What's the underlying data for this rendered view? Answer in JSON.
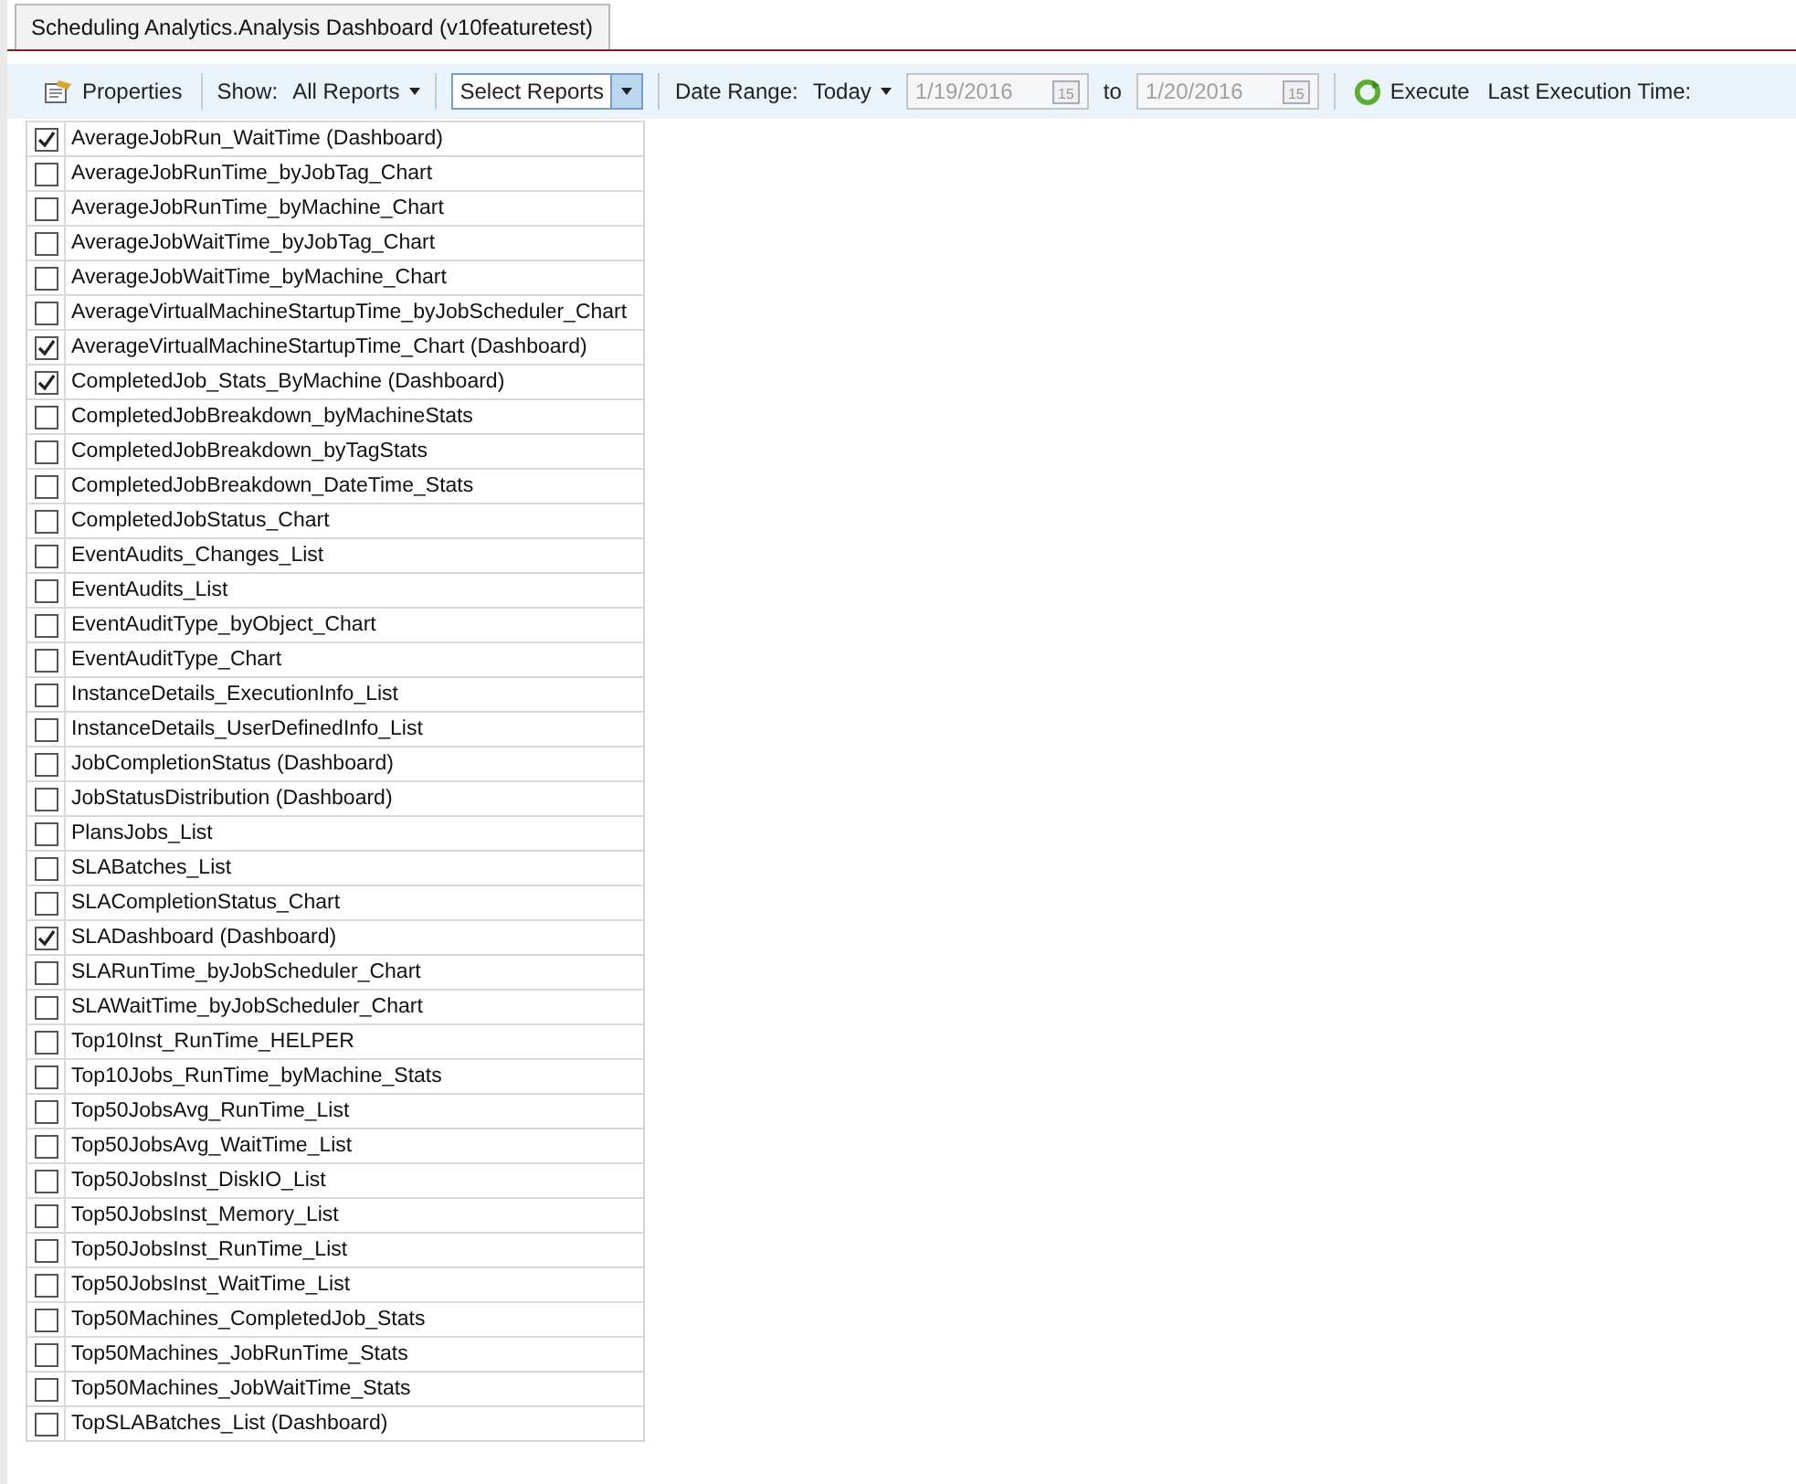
{
  "tab": {
    "title": "Scheduling Analytics.Analysis Dashboard (v10featuretest)",
    "selected": true
  },
  "toolbar": {
    "properties": "Properties",
    "show_label": "Show:",
    "show_value": "All Reports",
    "select_reports": "Select Reports",
    "date_range_label": "Date Range:",
    "date_range_value": "Today",
    "from_date": "1/19/2016",
    "to_label": "to",
    "to_date": "1/20/2016",
    "from_calendar_day": "15",
    "to_calendar_day": "15",
    "execute": "Execute",
    "last_execution": "Last Execution Time:"
  },
  "reports": [
    {
      "name": "AverageJobRun_WaitTime (Dashboard)",
      "checked": true
    },
    {
      "name": "AverageJobRunTime_byJobTag_Chart",
      "checked": false
    },
    {
      "name": "AverageJobRunTime_byMachine_Chart",
      "checked": false
    },
    {
      "name": "AverageJobWaitTime_byJobTag_Chart",
      "checked": false
    },
    {
      "name": "AverageJobWaitTime_byMachine_Chart",
      "checked": false
    },
    {
      "name": "AverageVirtualMachineStartupTime_byJobScheduler_Chart",
      "checked": false
    },
    {
      "name": "AverageVirtualMachineStartupTime_Chart (Dashboard)",
      "checked": true
    },
    {
      "name": "CompletedJob_Stats_ByMachine (Dashboard)",
      "checked": true
    },
    {
      "name": "CompletedJobBreakdown_byMachineStats",
      "checked": false
    },
    {
      "name": "CompletedJobBreakdown_byTagStats",
      "checked": false
    },
    {
      "name": "CompletedJobBreakdown_DateTime_Stats",
      "checked": false
    },
    {
      "name": "CompletedJobStatus_Chart",
      "checked": false
    },
    {
      "name": "EventAudits_Changes_List",
      "checked": false
    },
    {
      "name": "EventAudits_List",
      "checked": false
    },
    {
      "name": "EventAuditType_byObject_Chart",
      "checked": false
    },
    {
      "name": "EventAuditType_Chart",
      "checked": false
    },
    {
      "name": "InstanceDetails_ExecutionInfo_List",
      "checked": false
    },
    {
      "name": "InstanceDetails_UserDefinedInfo_List",
      "checked": false
    },
    {
      "name": "JobCompletionStatus (Dashboard)",
      "checked": false
    },
    {
      "name": "JobStatusDistribution (Dashboard)",
      "checked": false
    },
    {
      "name": "PlansJobs_List",
      "checked": false
    },
    {
      "name": "SLABatches_List",
      "checked": false
    },
    {
      "name": "SLACompletionStatus_Chart",
      "checked": false
    },
    {
      "name": "SLADashboard (Dashboard)",
      "checked": true
    },
    {
      "name": "SLARunTime_byJobScheduler_Chart",
      "checked": false
    },
    {
      "name": "SLAWaitTime_byJobScheduler_Chart",
      "checked": false
    },
    {
      "name": "Top10Inst_RunTime_HELPER",
      "checked": false
    },
    {
      "name": "Top10Jobs_RunTime_byMachine_Stats",
      "checked": false
    },
    {
      "name": "Top50JobsAvg_RunTime_List",
      "checked": false
    },
    {
      "name": "Top50JobsAvg_WaitTime_List",
      "checked": false
    },
    {
      "name": "Top50JobsInst_DiskIO_List",
      "checked": false
    },
    {
      "name": "Top50JobsInst_Memory_List",
      "checked": false
    },
    {
      "name": "Top50JobsInst_RunTime_List",
      "checked": false
    },
    {
      "name": "Top50JobsInst_WaitTime_List",
      "checked": false
    },
    {
      "name": "Top50Machines_CompletedJob_Stats",
      "checked": false
    },
    {
      "name": "Top50Machines_JobRunTime_Stats",
      "checked": false
    },
    {
      "name": "Top50Machines_JobWaitTime_Stats",
      "checked": false
    },
    {
      "name": "TopSLABatches_List (Dashboard)",
      "checked": false
    }
  ]
}
